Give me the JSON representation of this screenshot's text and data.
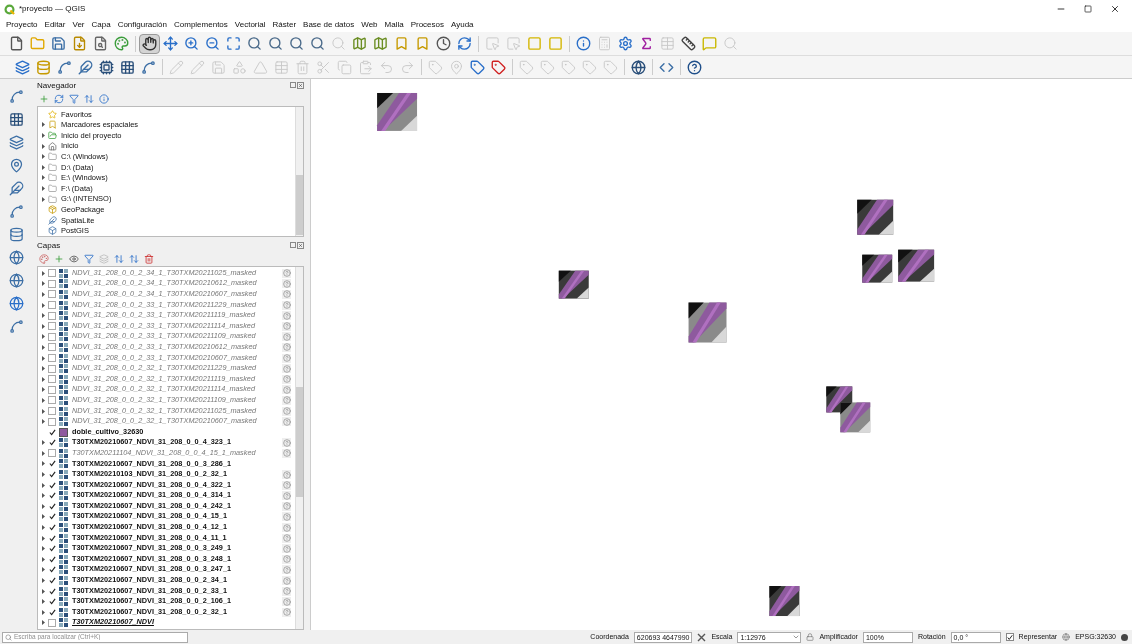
{
  "window": {
    "title": "*proyecto — QGIS"
  },
  "menu": [
    "Proyecto",
    "Editar",
    "Ver",
    "Capa",
    "Configuración",
    "Complementos",
    "Vectorial",
    "Ráster",
    "Base de datos",
    "Web",
    "Malla",
    "Procesos",
    "Ayuda"
  ],
  "toolbar_1": [
    [
      {
        "kind": "new",
        "disabled": false,
        "pressed": false
      },
      {
        "kind": "open",
        "disabled": false,
        "pressed": false
      },
      {
        "kind": "save",
        "disabled": false,
        "pressed": false
      },
      {
        "kind": "save_as",
        "disabled": false,
        "pressed": false
      },
      {
        "kind": "print",
        "disabled": false,
        "pressed": false
      },
      {
        "kind": "style",
        "disabled": false,
        "pressed": false
      }
    ],
    [
      {
        "kind": "pan",
        "disabled": false,
        "pressed": true
      },
      {
        "kind": "move",
        "disabled": false,
        "pressed": false
      },
      {
        "kind": "zoom_in",
        "disabled": false,
        "pressed": false
      },
      {
        "kind": "zoom_out",
        "disabled": false,
        "pressed": false
      },
      {
        "kind": "full",
        "disabled": false,
        "pressed": false
      },
      {
        "kind": "zoom",
        "disabled": false,
        "pressed": false
      },
      {
        "kind": "zoom",
        "disabled": false,
        "pressed": false
      },
      {
        "kind": "zoom",
        "disabled": false,
        "pressed": false
      },
      {
        "kind": "zoom",
        "disabled": false,
        "pressed": false
      },
      {
        "kind": "zoom",
        "disabled": true,
        "pressed": false
      },
      {
        "kind": "map",
        "disabled": false,
        "pressed": false
      },
      {
        "kind": "map",
        "disabled": false,
        "pressed": false
      },
      {
        "kind": "bookmark",
        "disabled": false,
        "pressed": false
      },
      {
        "kind": "bookmark",
        "disabled": false,
        "pressed": false
      },
      {
        "kind": "clock",
        "disabled": false,
        "pressed": false
      },
      {
        "kind": "refresh",
        "disabled": false,
        "pressed": false
      }
    ],
    [
      {
        "kind": "select",
        "disabled": true,
        "pressed": false
      },
      {
        "kind": "select",
        "disabled": true,
        "pressed": false
      },
      {
        "kind": "select_yellow",
        "disabled": false,
        "pressed": false
      },
      {
        "kind": "select_yellow",
        "disabled": false,
        "pressed": false
      }
    ],
    [
      {
        "kind": "info",
        "disabled": false,
        "pressed": false
      },
      {
        "kind": "calculator",
        "disabled": true,
        "pressed": false
      },
      {
        "kind": "gear",
        "disabled": false,
        "pressed": false
      },
      {
        "kind": "sigma",
        "disabled": false,
        "pressed": false
      },
      {
        "kind": "table",
        "disabled": true,
        "pressed": false
      },
      {
        "kind": "ruler",
        "disabled": false,
        "pressed": false
      },
      {
        "kind": "comment",
        "disabled": false,
        "pressed": false
      },
      {
        "kind": "search",
        "disabled": true,
        "pressed": false
      }
    ]
  ],
  "toolbar_2": [
    [
      {
        "kind": "layers",
        "disabled": false,
        "pressed": false
      },
      {
        "kind": "database",
        "disabled": false,
        "pressed": false
      },
      {
        "kind": "vector",
        "disabled": false,
        "pressed": false
      },
      {
        "kind": "feather",
        "disabled": false,
        "pressed": false
      },
      {
        "kind": "chip",
        "disabled": false,
        "pressed": false
      },
      {
        "kind": "grid",
        "disabled": false,
        "pressed": false
      },
      {
        "kind": "vector",
        "disabled": false,
        "pressed": false
      }
    ],
    [
      {
        "kind": "pencil",
        "disabled": true,
        "pressed": false
      },
      {
        "kind": "pencil",
        "disabled": true,
        "pressed": false
      },
      {
        "kind": "save",
        "disabled": true,
        "pressed": false
      },
      {
        "kind": "shapes",
        "disabled": true,
        "pressed": false
      },
      {
        "kind": "vertex",
        "disabled": true,
        "pressed": false
      },
      {
        "kind": "table",
        "disabled": true,
        "pressed": false
      },
      {
        "kind": "trash",
        "disabled": true,
        "pressed": false
      },
      {
        "kind": "cut",
        "disabled": true,
        "pressed": false
      },
      {
        "kind": "copy",
        "disabled": true,
        "pressed": false
      },
      {
        "kind": "paste",
        "disabled": true,
        "pressed": false
      },
      {
        "kind": "undo",
        "disabled": true,
        "pressed": false
      },
      {
        "kind": "redo",
        "disabled": true,
        "pressed": false
      }
    ],
    [
      {
        "kind": "tag",
        "disabled": true,
        "pressed": false
      },
      {
        "kind": "pin",
        "disabled": true,
        "pressed": false
      },
      {
        "kind": "tag_blue",
        "disabled": false,
        "pressed": false
      },
      {
        "kind": "tag_red",
        "disabled": false,
        "pressed": false
      }
    ],
    [
      {
        "kind": "tag",
        "disabled": true,
        "pressed": false
      },
      {
        "kind": "tag",
        "disabled": true,
        "pressed": false
      },
      {
        "kind": "tag",
        "disabled": true,
        "pressed": false
      },
      {
        "kind": "tag",
        "disabled": true,
        "pressed": false
      },
      {
        "kind": "tag",
        "disabled": true,
        "pressed": false
      }
    ],
    [
      {
        "kind": "globe",
        "disabled": false,
        "pressed": false
      }
    ],
    [
      {
        "kind": "python",
        "disabled": false,
        "pressed": false
      }
    ],
    [
      {
        "kind": "help",
        "disabled": false,
        "pressed": false
      }
    ]
  ],
  "browser": {
    "title": "Navegador",
    "items": [
      {
        "label": "Favoritos",
        "kind": "star",
        "expandable": false
      },
      {
        "label": "Marcadores espaciales",
        "kind": "bookmark",
        "expandable": true
      },
      {
        "label": "Inicio del proyecto",
        "kind": "project",
        "expandable": true
      },
      {
        "label": "Inicio",
        "kind": "home",
        "expandable": true
      },
      {
        "label": "C:\\ (Windows)",
        "kind": "folder",
        "expandable": true
      },
      {
        "label": "D:\\ (Data)",
        "kind": "folder",
        "expandable": true
      },
      {
        "label": "E:\\ (Windows)",
        "kind": "folder",
        "expandable": true
      },
      {
        "label": "F:\\ (Data)",
        "kind": "folder",
        "expandable": true
      },
      {
        "label": "G:\\ (INTENSO)",
        "kind": "folder",
        "expandable": true
      },
      {
        "label": "GeoPackage",
        "kind": "geopackage",
        "expandable": false
      },
      {
        "label": "SpatiaLite",
        "kind": "feather",
        "expandable": false
      },
      {
        "label": "PostGIS",
        "kind": "elephant",
        "expandable": false
      }
    ]
  },
  "layers": {
    "title": "Capas",
    "items": [
      {
        "name": "NDVI_31_208_0_0_2_34_1_T30TXM20211025_masked",
        "kind": "raster",
        "checked": false,
        "unavailable": true,
        "warning": true,
        "current": false
      },
      {
        "name": "NDVI_31_208_0_0_2_34_1_T30TXM20210612_masked",
        "kind": "raster",
        "checked": false,
        "unavailable": true,
        "warning": true,
        "current": false
      },
      {
        "name": "NDVI_31_208_0_0_2_34_1_T30TXM20210607_masked",
        "kind": "raster",
        "checked": false,
        "unavailable": true,
        "warning": true,
        "current": false
      },
      {
        "name": "NDVI_31_208_0_0_2_33_1_T30TXM20211229_masked",
        "kind": "raster",
        "checked": false,
        "unavailable": true,
        "warning": true,
        "current": false
      },
      {
        "name": "NDVI_31_208_0_0_2_33_1_T30TXM20211119_masked",
        "kind": "raster",
        "checked": false,
        "unavailable": true,
        "warning": true,
        "current": false
      },
      {
        "name": "NDVI_31_208_0_0_2_33_1_T30TXM20211114_masked",
        "kind": "raster",
        "checked": false,
        "unavailable": true,
        "warning": true,
        "current": false
      },
      {
        "name": "NDVI_31_208_0_0_2_33_1_T30TXM20211109_masked",
        "kind": "raster",
        "checked": false,
        "unavailable": true,
        "warning": true,
        "current": false
      },
      {
        "name": "NDVI_31_208_0_0_2_33_1_T30TXM20210612_masked",
        "kind": "raster",
        "checked": false,
        "unavailable": true,
        "warning": true,
        "current": false
      },
      {
        "name": "NDVI_31_208_0_0_2_33_1_T30TXM20210607_masked",
        "kind": "raster",
        "checked": false,
        "unavailable": true,
        "warning": true,
        "current": false
      },
      {
        "name": "NDVI_31_208_0_0_2_32_1_T30TXM20211229_masked",
        "kind": "raster",
        "checked": false,
        "unavailable": true,
        "warning": true,
        "current": false
      },
      {
        "name": "NDVI_31_208_0_0_2_32_1_T30TXM20211119_masked",
        "kind": "raster",
        "checked": false,
        "unavailable": true,
        "warning": true,
        "current": false
      },
      {
        "name": "NDVI_31_208_0_0_2_32_1_T30TXM20211114_masked",
        "kind": "raster",
        "checked": false,
        "unavailable": true,
        "warning": true,
        "current": false
      },
      {
        "name": "NDVI_31_208_0_0_2_32_1_T30TXM20211109_masked",
        "kind": "raster",
        "checked": false,
        "unavailable": true,
        "warning": true,
        "current": false
      },
      {
        "name": "NDVI_31_208_0_0_2_32_1_T30TXM20211025_masked",
        "kind": "raster",
        "checked": false,
        "unavailable": true,
        "warning": true,
        "current": false
      },
      {
        "name": "NDVI_31_208_0_0_2_32_1_T30TXM20210607_masked",
        "kind": "raster",
        "checked": false,
        "unavailable": true,
        "warning": true,
        "current": false
      },
      {
        "name": "doble_cultivo_32630",
        "kind": "vector",
        "color": "#8e5a9e",
        "checked": true,
        "unavailable": false,
        "warning": false,
        "current": false
      },
      {
        "name": "T30TXM20210607_NDVI_31_208_0_0_4_323_1",
        "kind": "raster",
        "checked": true,
        "unavailable": false,
        "warning": true,
        "current": false
      },
      {
        "name": "T30TXM20211104_NDVI_31_208_0_0_4_15_1_masked",
        "kind": "raster",
        "checked": false,
        "unavailable": true,
        "warning": true,
        "current": false
      },
      {
        "name": "T30TXM20210607_NDVI_31_208_0_0_3_286_1",
        "kind": "raster",
        "checked": true,
        "unavailable": false,
        "warning": false,
        "current": false
      },
      {
        "name": "T30TXM20210103_NDVI_31_208_0_0_2_32_1",
        "kind": "raster",
        "checked": true,
        "unavailable": false,
        "warning": true,
        "current": false
      },
      {
        "name": "T30TXM20210607_NDVI_31_208_0_0_4_322_1",
        "kind": "raster",
        "checked": true,
        "unavailable": false,
        "warning": true,
        "current": false
      },
      {
        "name": "T30TXM20210607_NDVI_31_208_0_0_4_314_1",
        "kind": "raster",
        "checked": true,
        "unavailable": false,
        "warning": true,
        "current": false
      },
      {
        "name": "T30TXM20210607_NDVI_31_208_0_0_4_242_1",
        "kind": "raster",
        "checked": true,
        "unavailable": false,
        "warning": true,
        "current": false
      },
      {
        "name": "T30TXM20210607_NDVI_31_208_0_0_4_15_1",
        "kind": "raster",
        "checked": true,
        "unavailable": false,
        "warning": true,
        "current": false
      },
      {
        "name": "T30TXM20210607_NDVI_31_208_0_0_4_12_1",
        "kind": "raster",
        "checked": true,
        "unavailable": false,
        "warning": true,
        "current": false
      },
      {
        "name": "T30TXM20210607_NDVI_31_208_0_0_4_11_1",
        "kind": "raster",
        "checked": true,
        "unavailable": false,
        "warning": true,
        "current": false
      },
      {
        "name": "T30TXM20210607_NDVI_31_208_0_0_3_249_1",
        "kind": "raster",
        "checked": true,
        "unavailable": false,
        "warning": true,
        "current": false
      },
      {
        "name": "T30TXM20210607_NDVI_31_208_0_0_3_248_1",
        "kind": "raster",
        "checked": true,
        "unavailable": false,
        "warning": true,
        "current": false
      },
      {
        "name": "T30TXM20210607_NDVI_31_208_0_0_3_247_1",
        "kind": "raster",
        "checked": true,
        "unavailable": false,
        "warning": true,
        "current": false
      },
      {
        "name": "T30TXM20210607_NDVI_31_208_0_0_2_34_1",
        "kind": "raster",
        "checked": true,
        "unavailable": false,
        "warning": true,
        "current": false
      },
      {
        "name": "T30TXM20210607_NDVI_31_208_0_0_2_33_1",
        "kind": "raster",
        "checked": true,
        "unavailable": false,
        "warning": true,
        "current": false
      },
      {
        "name": "T30TXM20210607_NDVI_31_208_0_0_2_106_1",
        "kind": "raster",
        "checked": true,
        "unavailable": false,
        "warning": true,
        "current": false
      },
      {
        "name": "T30TXM20210607_NDVI_31_208_0_0_2_32_1",
        "kind": "raster",
        "checked": true,
        "unavailable": false,
        "warning": true,
        "current": false
      },
      {
        "name": "T30TXM20210607_NDVI",
        "kind": "raster",
        "checked": false,
        "unavailable": false,
        "warning": false,
        "current": true
      }
    ]
  },
  "status_bar": {
    "search": {
      "placeholder": "Escriba para localizar (Ctrl+K)"
    },
    "coordinate_label": "Coordenada",
    "coordinate": "620693 4647990",
    "scale_label": "Escala",
    "scale": "1:12976",
    "magnifier_label": "Amplificador",
    "magnifier": "100%",
    "rotation_label": "Rotación",
    "rotation": "0,0 °",
    "render": {
      "label": "Representar",
      "checked": true
    },
    "crs": "EPSG:32630"
  }
}
